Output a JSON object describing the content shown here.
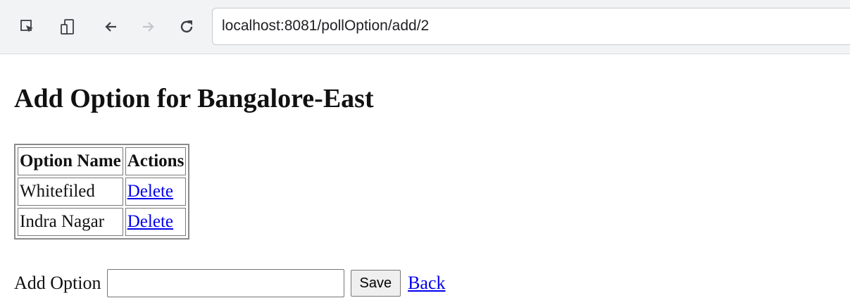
{
  "browser": {
    "url": "localhost:8081/pollOption/add/2",
    "icons": [
      "inspect-icon",
      "device-toggle-icon",
      "back-arrow-icon",
      "forward-arrow-icon",
      "reload-icon"
    ]
  },
  "page": {
    "title": "Add Option for Bangalore-East"
  },
  "table": {
    "headers": [
      "Option Name",
      "Actions"
    ],
    "rows": [
      {
        "name": "Whitefiled",
        "action": "Delete"
      },
      {
        "name": "Indra Nagar",
        "action": "Delete"
      }
    ]
  },
  "form": {
    "label": "Add Option",
    "input_value": "",
    "save_label": "Save",
    "back_label": "Back"
  }
}
